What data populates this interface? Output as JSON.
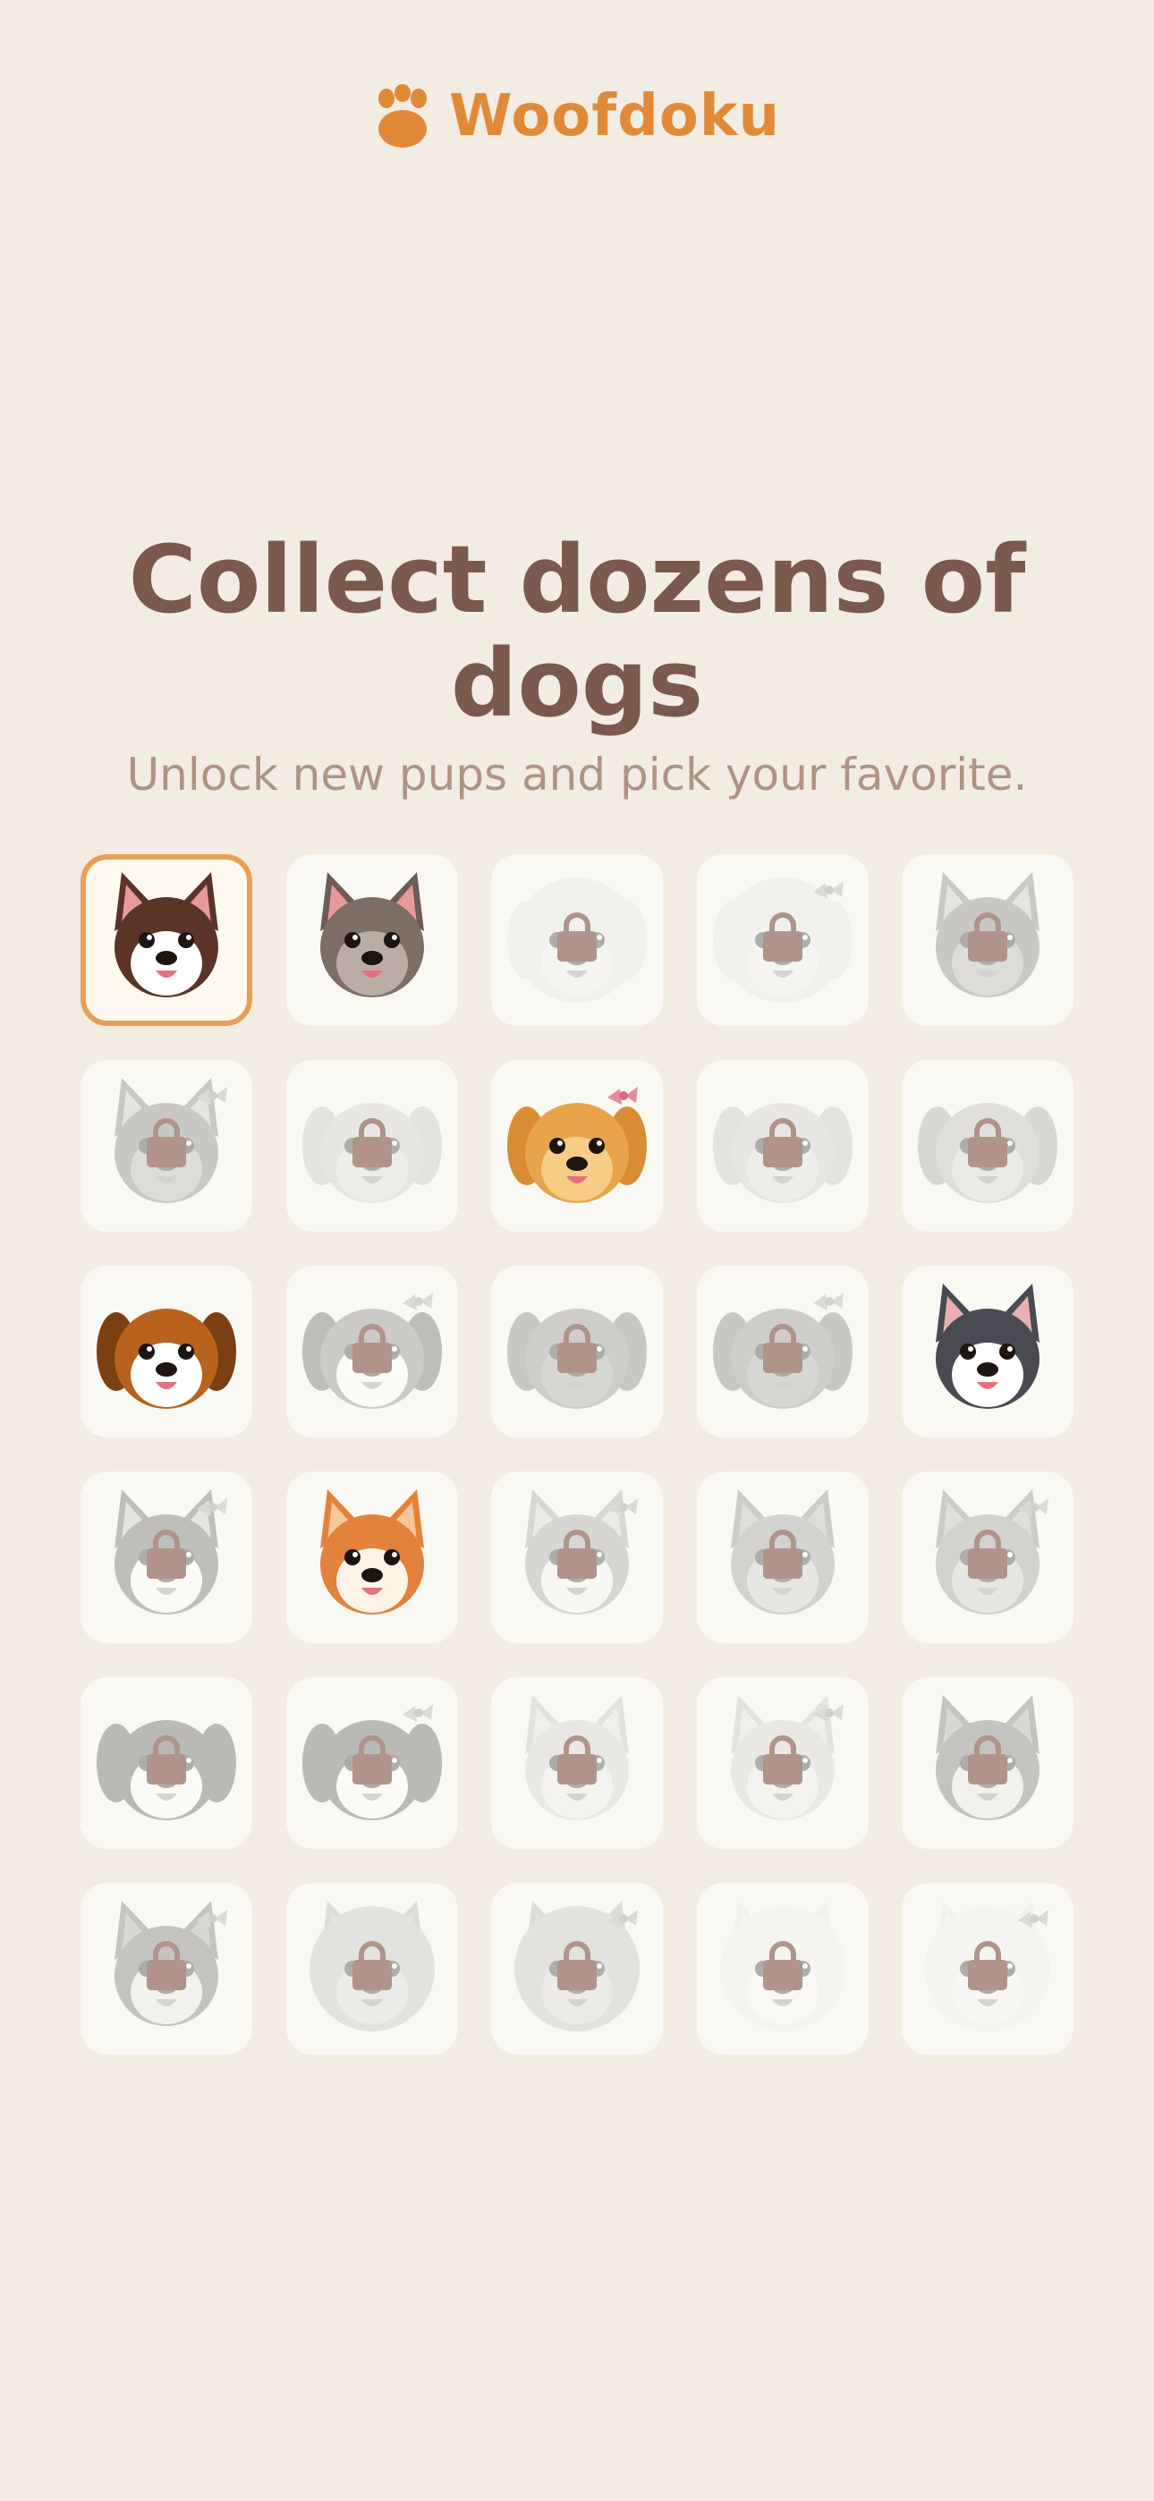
{
  "app": {
    "name": "Woofdoku",
    "logo_icon": "paw-icon",
    "accent_color": "#e08a38"
  },
  "hero": {
    "title": "Collect dozens of dogs",
    "subtitle": "Unlock new pups and pick your favorite."
  },
  "colors": {
    "background": "#f3ece2",
    "title": "#7a5a4c",
    "subtitle": "#b19384",
    "tile": "#faf8f2",
    "selected_border": "#ea9e55",
    "lock": "#b0948a"
  },
  "dogs": [
    {
      "icon": "french-bulldog-icon",
      "state": "selected"
    },
    {
      "icon": "merle-french-bulldog-icon",
      "state": "unlocked"
    },
    {
      "icon": "poodle-icon",
      "state": "locked"
    },
    {
      "icon": "poodle-bow-icon",
      "state": "locked"
    },
    {
      "icon": "german-shepherd-icon",
      "state": "locked"
    },
    {
      "icon": "german-shepherd-bow-icon",
      "state": "locked"
    },
    {
      "icon": "labrador-icon",
      "state": "locked"
    },
    {
      "icon": "golden-retriever-bow-icon",
      "state": "unlocked"
    },
    {
      "icon": "labrador-icon",
      "state": "locked"
    },
    {
      "icon": "golden-retriever-icon",
      "state": "locked"
    },
    {
      "icon": "beagle-icon",
      "state": "unlocked"
    },
    {
      "icon": "beagle-bow-icon",
      "state": "locked"
    },
    {
      "icon": "dachshund-icon",
      "state": "locked"
    },
    {
      "icon": "dachshund-bow-icon",
      "state": "locked"
    },
    {
      "icon": "husky-icon",
      "state": "unlocked"
    },
    {
      "icon": "husky-bow-icon",
      "state": "locked"
    },
    {
      "icon": "shiba-inu-icon",
      "state": "unlocked"
    },
    {
      "icon": "shiba-inu-bow-icon",
      "state": "locked"
    },
    {
      "icon": "yorkshire-terrier-icon",
      "state": "locked"
    },
    {
      "icon": "yorkshire-terrier-bow-icon",
      "state": "locked"
    },
    {
      "icon": "bernese-mountain-dog-icon",
      "state": "locked"
    },
    {
      "icon": "bernese-mountain-dog-bow-icon",
      "state": "locked"
    },
    {
      "icon": "corgi-icon",
      "state": "locked"
    },
    {
      "icon": "corgi-bow-icon",
      "state": "locked"
    },
    {
      "icon": "alaskan-malamute-icon",
      "state": "locked"
    },
    {
      "icon": "alaskan-malamute-bow-icon",
      "state": "locked"
    },
    {
      "icon": "chow-chow-icon",
      "state": "locked"
    },
    {
      "icon": "chow-chow-bow-icon",
      "state": "locked"
    },
    {
      "icon": "samoyed-icon",
      "state": "locked"
    },
    {
      "icon": "samoyed-bow-icon",
      "state": "locked"
    }
  ]
}
